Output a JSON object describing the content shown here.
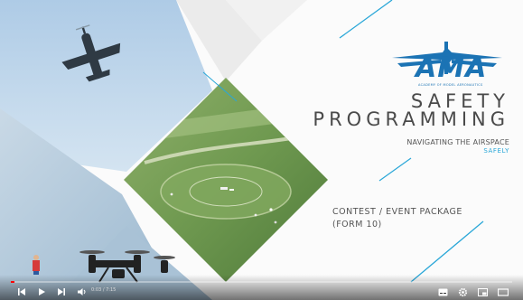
{
  "logo": {
    "text": "AMA",
    "subtext": "ACADEMY OF MODEL AERONAUTICS"
  },
  "title": {
    "line1": "SAFETY",
    "line2": "PROGRAMMING"
  },
  "subtitle": {
    "line1": "NAVIGATING THE AIRSPACE",
    "line2": "SAFELY"
  },
  "package": {
    "line1": "CONTEST / EVENT PACKAGE",
    "line2": "(FORM 10)"
  },
  "player": {
    "timecode": "0:03 / 7:15",
    "progress": 0.007,
    "icons": [
      "previous-icon",
      "play-icon",
      "next-icon",
      "volume-icon",
      "captions-icon",
      "settings-icon",
      "miniplayer-icon",
      "theater-icon"
    ]
  },
  "colors": {
    "brand_blue": "#1b73b4",
    "accent_cyan": "#2aa7d8",
    "progress_red": "#ff0000"
  }
}
